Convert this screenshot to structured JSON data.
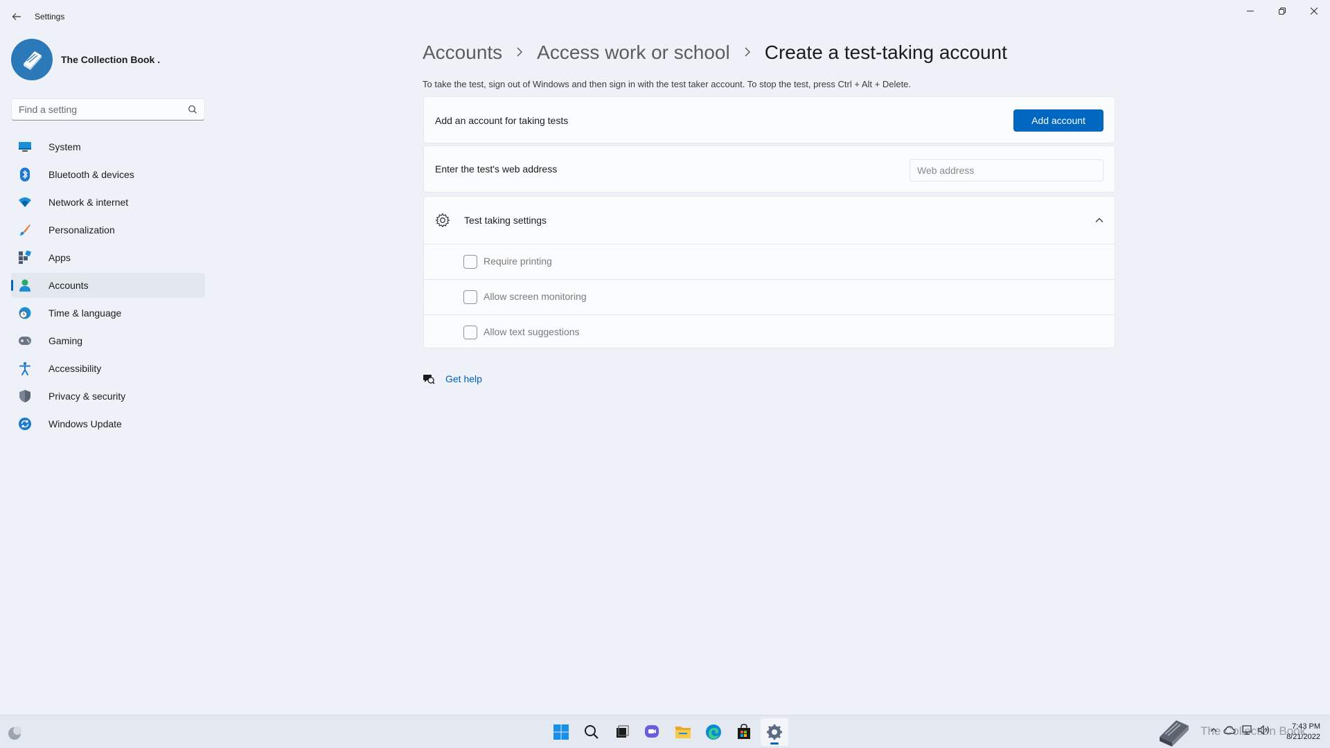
{
  "window": {
    "title": "Settings"
  },
  "profile": {
    "name": "The Collection Book ."
  },
  "search": {
    "placeholder": "Find a setting"
  },
  "sidebar": {
    "items": [
      {
        "label": "System",
        "icon": "monitor-icon"
      },
      {
        "label": "Bluetooth & devices",
        "icon": "bluetooth-icon"
      },
      {
        "label": "Network & internet",
        "icon": "wifi-icon"
      },
      {
        "label": "Personalization",
        "icon": "brush-icon"
      },
      {
        "label": "Apps",
        "icon": "apps-icon"
      },
      {
        "label": "Accounts",
        "icon": "person-icon",
        "active": true
      },
      {
        "label": "Time & language",
        "icon": "globe-clock-icon"
      },
      {
        "label": "Gaming",
        "icon": "gamepad-icon"
      },
      {
        "label": "Accessibility",
        "icon": "accessibility-icon"
      },
      {
        "label": "Privacy & security",
        "icon": "shield-icon"
      },
      {
        "label": "Windows Update",
        "icon": "update-icon"
      }
    ]
  },
  "breadcrumb": {
    "items": [
      "Accounts",
      "Access work or school",
      "Create a test-taking account"
    ]
  },
  "main": {
    "description": "To take the test, sign out of Windows and then sign in with the test taker account. To stop the test, press Ctrl + Alt + Delete.",
    "add_account": {
      "label": "Add an account for taking tests",
      "button": "Add account"
    },
    "web_address": {
      "label": "Enter the test's web address",
      "placeholder": "Web address",
      "value": ""
    },
    "test_settings": {
      "title": "Test taking settings",
      "expanded": true,
      "options": [
        {
          "label": "Require printing",
          "checked": false
        },
        {
          "label": "Allow screen monitoring",
          "checked": false
        },
        {
          "label": "Allow text suggestions",
          "checked": false
        }
      ]
    },
    "help": {
      "label": "Get help"
    }
  },
  "taskbar": {
    "apps": [
      "start-icon",
      "search-icon",
      "task-view-icon",
      "chat-icon",
      "file-explorer-icon",
      "edge-icon",
      "store-icon",
      "settings-icon"
    ],
    "active_app": "settings-icon",
    "watermark": "The Collection Book",
    "time": "7:43 PM",
    "date": "8/21/2022"
  },
  "colors": {
    "accent": "#0067c0",
    "background": "#eef2f8",
    "card": "#fbfcfd",
    "link": "#0060b8"
  }
}
